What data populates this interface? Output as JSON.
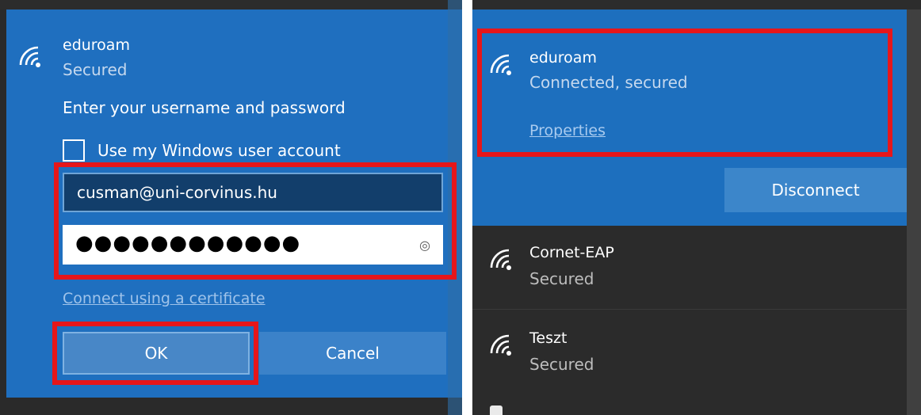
{
  "left_panel": {
    "network": {
      "name": "eduroam",
      "status": "Secured",
      "icon": "wifi-icon"
    },
    "prompt": "Enter your username and password",
    "checkbox": {
      "label": "Use my Windows user account",
      "checked": false
    },
    "username": {
      "value": "cusman@uni-corvinus.hu"
    },
    "password": {
      "masked_value": "●●●●●●●●●●●●",
      "reveal_icon": "eye-icon"
    },
    "certificate_link": "Connect using a certificate",
    "buttons": {
      "ok": "OK",
      "cancel": "Cancel"
    }
  },
  "right_panel": {
    "connected_network": {
      "name": "eduroam",
      "status": "Connected, secured",
      "properties_link": "Properties",
      "disconnect_label": "Disconnect"
    },
    "networks": [
      {
        "name": "Cornet-EAP",
        "status": "Secured"
      },
      {
        "name": "Teszt",
        "status": "Secured"
      }
    ]
  },
  "colors": {
    "accent_blue": "#1f6fbf",
    "highlight_red": "#e6161a",
    "dark_bg": "#2b2b2b"
  }
}
